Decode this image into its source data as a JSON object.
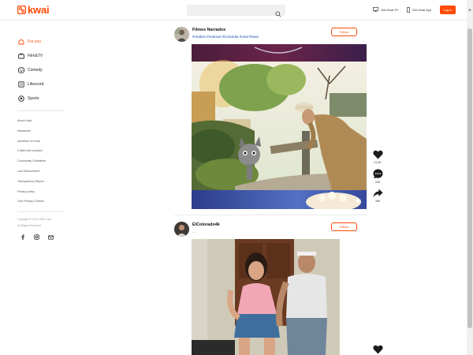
{
  "header": {
    "logo_text": "kwai",
    "search_placeholder": "",
    "get_pc_label": "Get Kwai PC",
    "get_app_label": "Get Kwai App",
    "login_label": "Log in",
    "brand_color": "#ff4906"
  },
  "sidebar": {
    "nav": [
      {
        "label": "For you",
        "icon": "home-icon",
        "active": true
      },
      {
        "label": "Film&TV",
        "icon": "tv-icon"
      },
      {
        "label": "Comedy",
        "icon": "smile-icon"
      },
      {
        "label": "Lifescord",
        "icon": "book-icon"
      },
      {
        "label": "Sports",
        "icon": "ball-icon"
      }
    ],
    "links": [
      "About Kwai",
      "Newsroom",
      "Advertise on Kwai",
      "Collab with creators",
      "Community Guidelines",
      "Law Enforcement",
      "Transparency Report",
      "Privacy policy",
      "Your Privacy Choices"
    ],
    "copyright_line1": "Copyright © 2012-2023 Joyo",
    "copyright_line2": "All Rights Reserved.",
    "socials": [
      "facebook-icon",
      "instagram-icon",
      "email-icon"
    ]
  },
  "posts": [
    {
      "author": "Filmes Narrados",
      "caption": "#viraliza #noticias #Comédia #viral #kwai",
      "follow_label": "Follow",
      "likes": "21.4K",
      "comments": "245",
      "shares": "456"
    },
    {
      "author": "ElColorado4k",
      "caption": "...",
      "follow_label": "Follow"
    }
  ]
}
